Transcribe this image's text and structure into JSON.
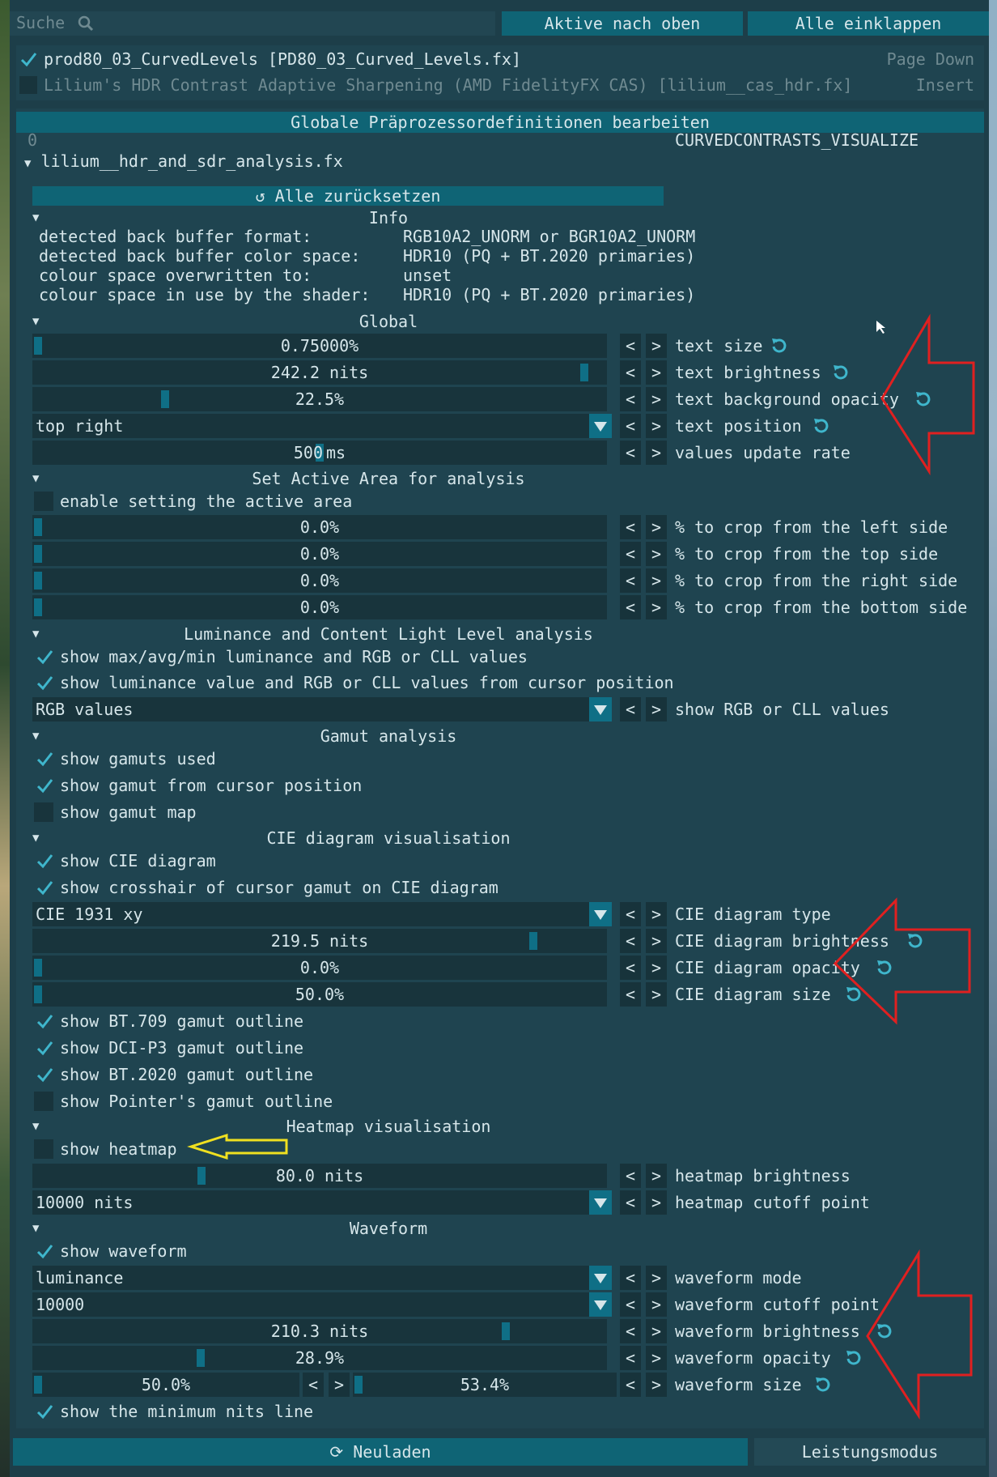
{
  "search": {
    "placeholder": "Suche"
  },
  "buttons": {
    "active_top": "Aktive nach oben",
    "collapse_all": "Alle einklappen",
    "reset_all": "Alle zurücksetzen",
    "reload": "Neuladen",
    "performance": "Leistungsmodus"
  },
  "effects": [
    {
      "name": "prod80_03_CurvedLevels [PD80_03_Curved_Levels.fx]",
      "enabled": true,
      "hotkey": "Page Down"
    },
    {
      "name": "Lilium's HDR Contrast Adaptive Sharpening (AMD FidelityFX CAS) [lilium__cas_hdr.fx]",
      "enabled": false,
      "hotkey": "Insert"
    }
  ],
  "preprocessor": {
    "header": "Globale Präprozessordefinitionen bearbeiten",
    "value": "0",
    "name": "CURVEDCONTRASTS_VISUALIZE"
  },
  "effect_file": "lilium__hdr_and_sdr_analysis.fx",
  "info": {
    "header": "Info",
    "rows": [
      {
        "label": "detected back buffer format:",
        "value": "RGB10A2_UNORM or BGR10A2_UNORM"
      },
      {
        "label": "detected back buffer color space:",
        "value": "HDR10 (PQ + BT.2020 primaries)"
      },
      {
        "label": "colour space overwritten to:",
        "value": "unset"
      },
      {
        "label": "colour space in use by the shader:",
        "value": "HDR10 (PQ + BT.2020 primaries)"
      }
    ]
  },
  "sections": {
    "global": "Global",
    "active_area": "Set Active Area for analysis",
    "luminance": "Luminance and Content Light Level analysis",
    "gamut": "Gamut analysis",
    "cie": "CIE diagram visualisation",
    "heatmap": "Heatmap visualisation",
    "waveform": "Waveform"
  },
  "global": {
    "text_size": {
      "value": "0.75000%",
      "label": "text size",
      "position": 0.0
    },
    "text_brightness": {
      "value": "242.2 nits",
      "label": "text brightness",
      "position": 0.97
    },
    "text_bg_opacity": {
      "value": "22.5%",
      "label": "text background opacity",
      "position": 0.225
    },
    "text_position": {
      "value": "top right",
      "label": "text position"
    },
    "update_rate": {
      "value": "500",
      "unit": "ms",
      "label": "values update rate",
      "position": 0.5
    }
  },
  "active_area": {
    "enable": {
      "label": "enable setting the active area",
      "checked": false
    },
    "crops": [
      {
        "value": "0.0%",
        "label": "% to crop from the left side"
      },
      {
        "value": "0.0%",
        "label": "% to crop from the top side"
      },
      {
        "value": "0.0%",
        "label": "% to crop from the right side"
      },
      {
        "value": "0.0%",
        "label": "% to crop from the bottom side"
      }
    ]
  },
  "luminance": {
    "show_maxavgmin": {
      "label": "show max/avg/min luminance and RGB or CLL values",
      "checked": true
    },
    "show_cursor": {
      "label": "show luminance value and RGB or CLL values from cursor position",
      "checked": true
    },
    "rgb_or_cll": {
      "value": "RGB values",
      "label": "show RGB or CLL values"
    }
  },
  "gamut": {
    "show_used": {
      "label": "show gamuts used",
      "checked": true
    },
    "show_cursor": {
      "label": "show gamut from cursor position",
      "checked": true
    },
    "show_map": {
      "label": "show gamut map",
      "checked": false
    }
  },
  "cie": {
    "show_diagram": {
      "label": "show CIE diagram",
      "checked": true
    },
    "show_crosshair": {
      "label": "show crosshair of cursor gamut on CIE diagram",
      "checked": true
    },
    "type": {
      "value": "CIE 1931 xy",
      "label": "CIE diagram type"
    },
    "brightness": {
      "value": "219.5 nits",
      "label": "CIE diagram brightness",
      "position": 0.88
    },
    "opacity": {
      "value": "0.0%",
      "label": "CIE diagram opacity",
      "position": 0.0
    },
    "size": {
      "value": "50.0%",
      "label": "CIE diagram size",
      "position": 0.0
    },
    "bt709": {
      "label": "show BT.709 gamut outline",
      "checked": true
    },
    "dcip3": {
      "label": "show DCI-P3 gamut outline",
      "checked": true
    },
    "bt2020": {
      "label": "show BT.2020 gamut outline",
      "checked": true
    },
    "pointer": {
      "label": "show Pointer's gamut outline",
      "checked": false
    }
  },
  "heatmap": {
    "show": {
      "label": "show heatmap",
      "checked": false
    },
    "brightness": {
      "value": "80.0 nits",
      "label": "heatmap brightness",
      "position": 0.29
    },
    "cutoff": {
      "value": "10000 nits",
      "label": "heatmap cutoff point"
    }
  },
  "waveform": {
    "show": {
      "label": "show waveform",
      "checked": true
    },
    "mode": {
      "value": "luminance",
      "label": "waveform mode"
    },
    "cutoff": {
      "value": "10000",
      "label": "waveform cutoff point"
    },
    "brightness": {
      "value": "210.3 nits",
      "label": "waveform brightness",
      "position": 0.83
    },
    "opacity": {
      "value": "28.9%",
      "label": "waveform opacity",
      "position": 0.289
    },
    "size_x": {
      "value": "50.0%",
      "position": 0.0
    },
    "size_y": {
      "value": "53.4%",
      "position": 0.0
    },
    "size_label": "waveform size",
    "show_min_nits": {
      "label": "show the minimum nits line",
      "checked": true
    }
  },
  "step_labels": {
    "prev": "<",
    "next": ">"
  },
  "colors": {
    "panel": "#1d3e49",
    "accent": "#0f6f86",
    "annotation_red": "#e02020",
    "annotation_yellow": "#f0e020"
  }
}
